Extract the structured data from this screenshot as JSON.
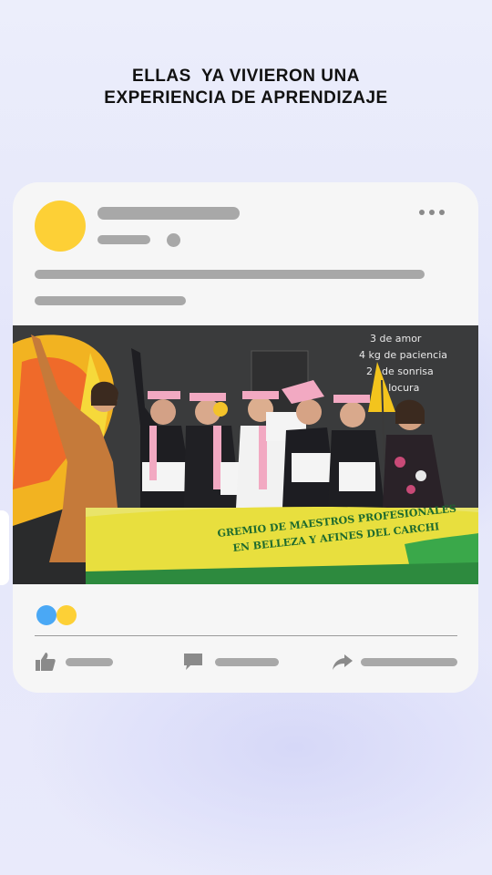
{
  "headline": {
    "line1": "ELLAS  YA VIVIERON UNA",
    "line2": "EXPERIENCIA DE APRENDIZAJE"
  },
  "post": {
    "avatar_color": "#fdd036",
    "reaction_colors": [
      "#4aa8f5",
      "#fdd036"
    ],
    "photo": {
      "banner_text_line1": "GREMIO DE MAESTROS PROFESIONALES",
      "banner_text_line2": "EN BELLEZA Y AFINES DEL CARCHI",
      "board_lines": [
        "3 de amor",
        "4 kg de paciencia",
        "2 l de sonrisa",
        "de locura"
      ]
    },
    "icons": [
      "more-options-icon",
      "like-thumb-icon",
      "comment-bubble-icon",
      "share-arrow-icon"
    ]
  }
}
